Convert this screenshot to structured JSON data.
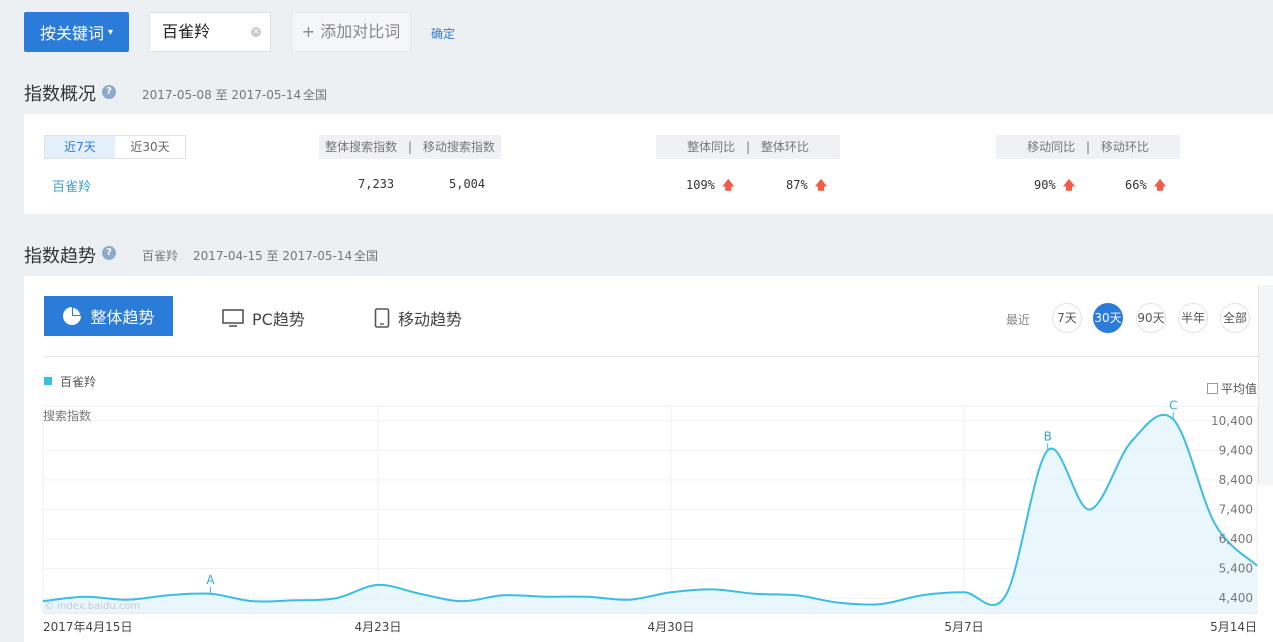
{
  "topbar": {
    "keyword_button": "按关键词",
    "keyword_value": "百雀羚",
    "add_compare": "添加对比词",
    "confirm": "确定"
  },
  "overview": {
    "title": "指数概况",
    "date_range": "2017-05-08 至 2017-05-14",
    "region": "全国",
    "range_tabs": [
      "近7天",
      "近30天"
    ],
    "headers": {
      "search_total": "整体搜索指数",
      "search_mobile": "移动搜索指数",
      "yoy_total": "整体同比",
      "mom_total": "整体环比",
      "yoy_mobile": "移动同比",
      "mom_mobile": "移动环比",
      "sep": "|"
    },
    "row": {
      "keyword": "百雀羚",
      "search_total": "7,233",
      "search_mobile": "5,004",
      "yoy_total": "109%",
      "mom_total": "87%",
      "yoy_mobile": "90%",
      "mom_mobile": "66%"
    },
    "up_arrow": "🡅"
  },
  "trend": {
    "title": "指数趋势",
    "keyword": "百雀羚",
    "date_range": "2017-04-15 至 2017-05-14",
    "region": "全国",
    "tabs": [
      "整体趋势",
      "PC趋势",
      "移动趋势"
    ],
    "recent_label": "最近",
    "range_buttons": [
      "7天",
      "30天",
      "90天",
      "半年",
      "全部"
    ],
    "active_range": "30天",
    "legend": "百雀羚",
    "avg_checkbox": "平均值",
    "ylabel": "搜索指数",
    "watermark": "© index.baidu.com",
    "color_accent": "#2b7bd8",
    "color_series": "#3bbde3"
  },
  "chart_data": {
    "type": "area",
    "ylabel": "搜索指数",
    "x_tick_labels": [
      "2017年4月15日",
      "4月23日",
      "4月30日",
      "5月7日",
      "5月14日"
    ],
    "y_tick_labels": [
      "4,400",
      "5,400",
      "6,400",
      "7,400",
      "8,400",
      "9,400",
      "10,400"
    ],
    "ylim": [
      3900,
      10900
    ],
    "series": [
      {
        "name": "百雀羚",
        "x": [
          "2017-04-15",
          "2017-04-16",
          "2017-04-17",
          "2017-04-18",
          "2017-04-19",
          "2017-04-20",
          "2017-04-21",
          "2017-04-22",
          "2017-04-23",
          "2017-04-24",
          "2017-04-25",
          "2017-04-26",
          "2017-04-27",
          "2017-04-28",
          "2017-04-29",
          "2017-04-30",
          "2017-05-01",
          "2017-05-02",
          "2017-05-03",
          "2017-05-04",
          "2017-05-05",
          "2017-05-06",
          "2017-05-07",
          "2017-05-08",
          "2017-05-09",
          "2017-05-10",
          "2017-05-11",
          "2017-05-12",
          "2017-05-13",
          "2017-05-14"
        ],
        "values": [
          4300,
          4450,
          4350,
          4500,
          4550,
          4300,
          4330,
          4400,
          4850,
          4550,
          4300,
          4500,
          4450,
          4450,
          4350,
          4600,
          4700,
          4550,
          4500,
          4250,
          4200,
          4500,
          4600,
          4500,
          9400,
          7400,
          9700,
          10450,
          6900,
          5500
        ]
      }
    ],
    "annotations": [
      {
        "label": "A",
        "x": "2017-04-19"
      },
      {
        "label": "B",
        "x": "2017-05-09"
      },
      {
        "label": "C",
        "x": "2017-05-12"
      }
    ],
    "grid": true
  }
}
